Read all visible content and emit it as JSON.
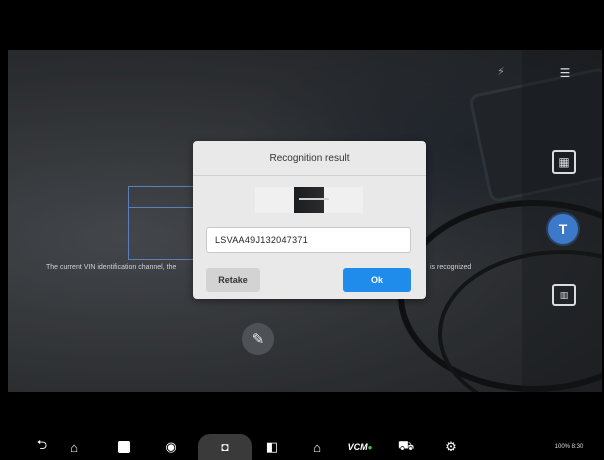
{
  "dialog": {
    "title": "Recognition result",
    "vin_value": "LSVAA49J132047371",
    "retake_label": "Retake",
    "ok_label": "Ok"
  },
  "scanner": {
    "hint_left": "The current VIN identification channel, the",
    "hint_right": "is recognized"
  },
  "toolbar_icons": {
    "flash": "flash-off-icon",
    "menu": "menu-icon",
    "scan": "scan-frame-icon",
    "text": "text-recognition-icon",
    "barcode": "barcode-icon",
    "edit": "edit-icon"
  },
  "taskbar": {
    "vcm_label": "VCM",
    "status_text": "100% 8:30"
  },
  "colors": {
    "primary_button": "#1f8ceb",
    "active_mode": "#3c79c8",
    "vcm_connected": "#3ec44a"
  }
}
